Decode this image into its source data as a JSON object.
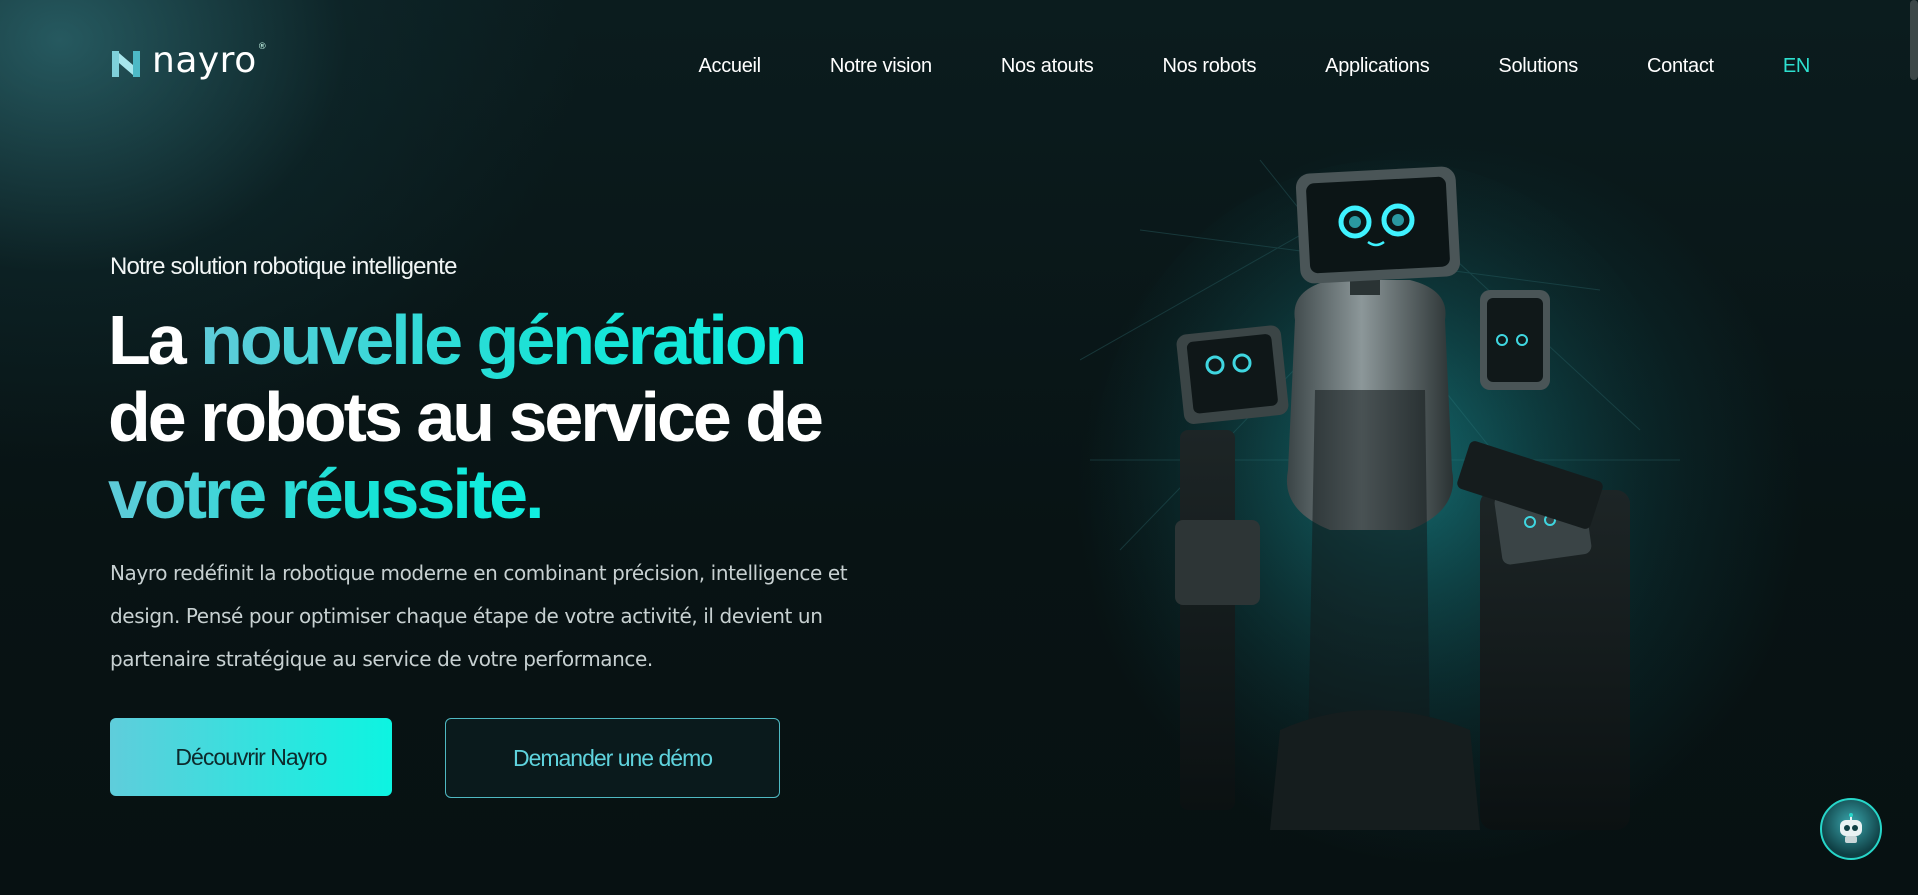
{
  "brand": {
    "name": "nayro",
    "trademark": "®",
    "accent_color": "#17e3d6"
  },
  "nav": {
    "items": [
      {
        "label": "Accueil"
      },
      {
        "label": "Notre vision"
      },
      {
        "label": "Nos atouts"
      },
      {
        "label": "Nos robots"
      },
      {
        "label": "Applications"
      },
      {
        "label": "Solutions"
      },
      {
        "label": "Contact"
      }
    ],
    "language": "EN"
  },
  "hero": {
    "eyebrow": "Notre solution robotique intelligente",
    "headline": {
      "line1_plain": "La ",
      "line1_accent": "nouvelle génération",
      "line2": "de robots au service de",
      "line3_accent": "votre réussite."
    },
    "lead": "Nayro redéfinit la robotique moderne en combinant précision, intelligence et design. Pensé pour optimiser chaque étape de votre activité, il devient un partenaire stratégique au service de votre performance.",
    "primary_cta": "Découvrir Nayro",
    "secondary_cta": "Demander une démo"
  },
  "icons": {
    "logo": "nayro-logo-icon",
    "chat": "robot-chat-icon"
  }
}
